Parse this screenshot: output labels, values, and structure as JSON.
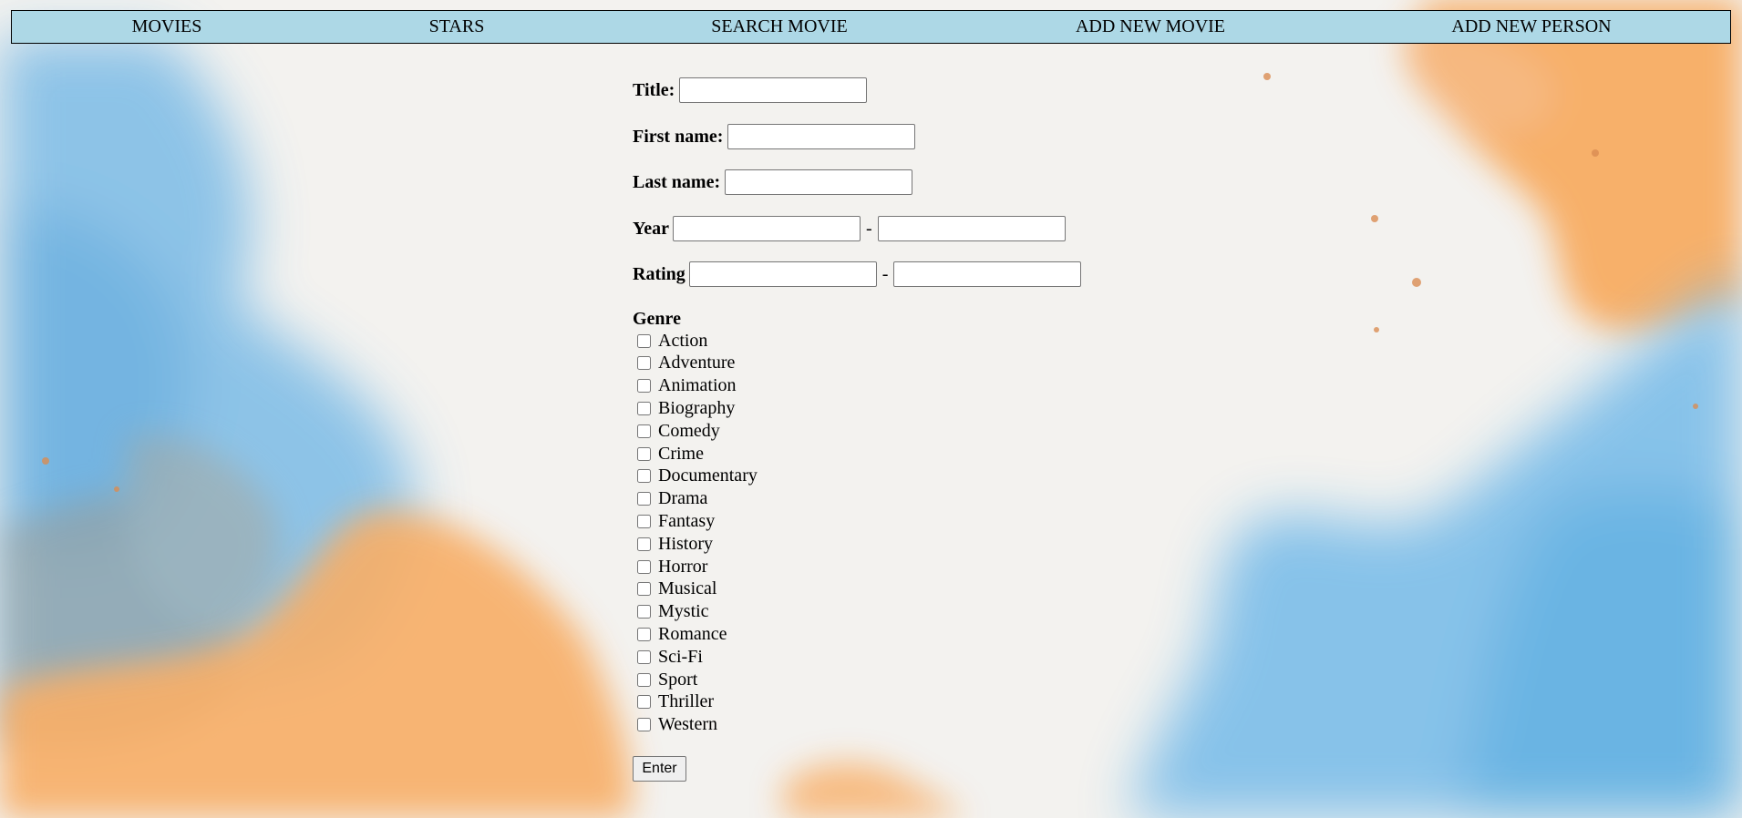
{
  "nav": {
    "items": [
      {
        "label": "MOVIES"
      },
      {
        "label": "STARS"
      },
      {
        "label": "SEARCH MOVIE"
      },
      {
        "label": "ADD NEW MOVIE"
      },
      {
        "label": "ADD NEW PERSON"
      }
    ],
    "background": "#add8e6"
  },
  "form": {
    "title": {
      "label": "Title:",
      "value": ""
    },
    "first_name": {
      "label": "First name:",
      "value": ""
    },
    "last_name": {
      "label": "Last name:",
      "value": ""
    },
    "year": {
      "label": "Year",
      "separator": "-",
      "from": "",
      "to": ""
    },
    "rating": {
      "label": "Rating",
      "separator": "-",
      "from": "",
      "to": ""
    },
    "genre": {
      "label": "Genre",
      "options": [
        {
          "label": "Action",
          "checked": false
        },
        {
          "label": "Adventure",
          "checked": false
        },
        {
          "label": "Animation",
          "checked": false
        },
        {
          "label": "Biography",
          "checked": false
        },
        {
          "label": "Comedy",
          "checked": false
        },
        {
          "label": "Crime",
          "checked": false
        },
        {
          "label": "Documentary",
          "checked": false
        },
        {
          "label": "Drama",
          "checked": false
        },
        {
          "label": "Fantasy",
          "checked": false
        },
        {
          "label": "History",
          "checked": false
        },
        {
          "label": "Horror",
          "checked": false
        },
        {
          "label": "Musical",
          "checked": false
        },
        {
          "label": "Mystic",
          "checked": false
        },
        {
          "label": "Romance",
          "checked": false
        },
        {
          "label": "Sci-Fi",
          "checked": false
        },
        {
          "label": "Sport",
          "checked": false
        },
        {
          "label": "Thriller",
          "checked": false
        },
        {
          "label": "Western",
          "checked": false
        }
      ]
    },
    "submit_label": "Enter"
  },
  "background": {
    "paper": "#f3f2ef",
    "blue": "#6fb5e4",
    "orange": "#f8a95c"
  }
}
